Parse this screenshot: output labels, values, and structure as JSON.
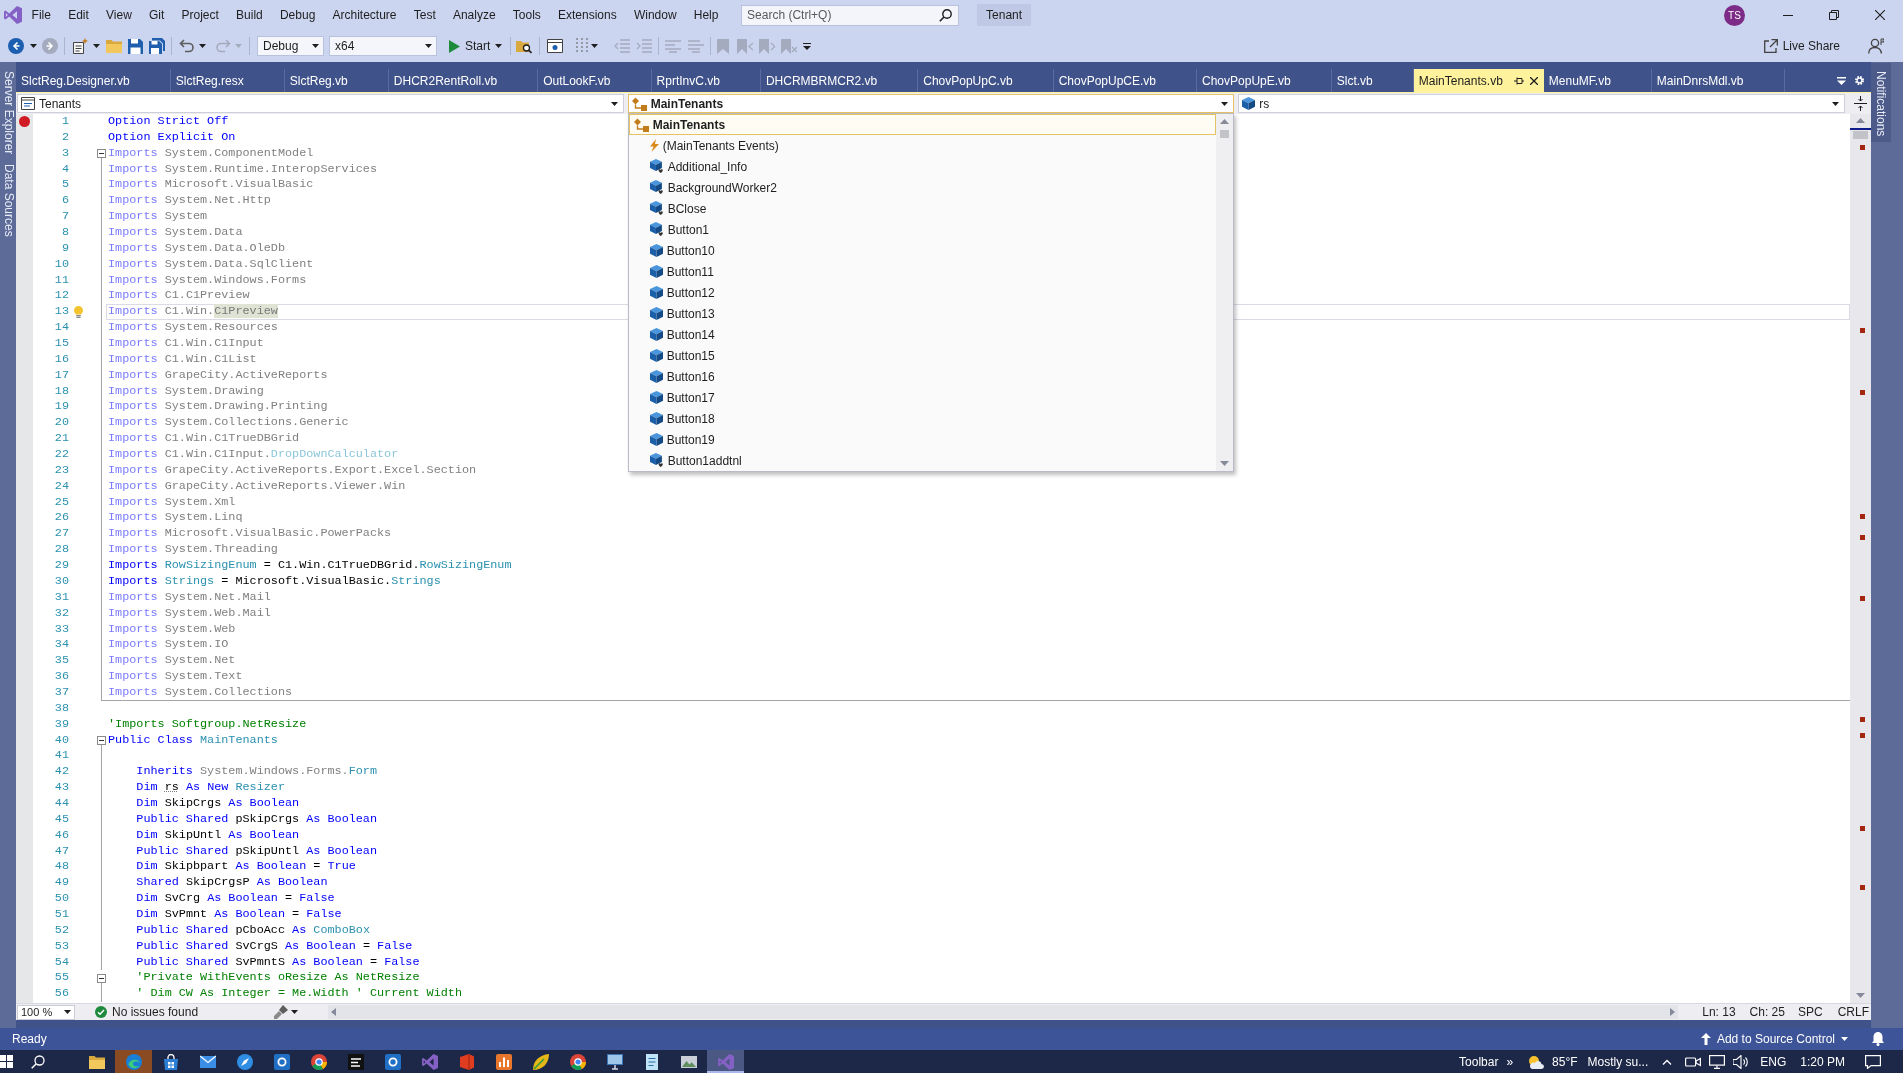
{
  "menu_bar": {
    "items": [
      "File",
      "Edit",
      "View",
      "Git",
      "Project",
      "Build",
      "Debug",
      "Architecture",
      "Test",
      "Analyze",
      "Tools",
      "Extensions",
      "Window",
      "Help"
    ],
    "search": {
      "placeholder": "Search (Ctrl+Q)"
    },
    "solution_name": "Tenant",
    "account_initials": "TS"
  },
  "toolbar": {
    "configuration": "Debug",
    "platform": "x64",
    "start": "Start",
    "live_share": "Live Share"
  },
  "left_tool_tabs": [
    "Server Explorer",
    "Data Sources"
  ],
  "right_tool_tabs": [
    "Notifications"
  ],
  "document_tabs": [
    {
      "label": "SlctReg.Designer.vb",
      "selected": false
    },
    {
      "label": "SlctReg.resx",
      "selected": false
    },
    {
      "label": "SlctReg.vb",
      "selected": false
    },
    {
      "label": "DHCR2RentRoll.vb",
      "selected": false
    },
    {
      "label": "OutLookF.vb",
      "selected": false
    },
    {
      "label": "RprtInvC.vb",
      "selected": false
    },
    {
      "label": "DHCRMBRMCR2.vb",
      "selected": false
    },
    {
      "label": "ChovPopUpC.vb",
      "selected": false
    },
    {
      "label": "ChovPopUpCE.vb",
      "selected": false
    },
    {
      "label": "ChovPopUpE.vb",
      "selected": false
    },
    {
      "label": "Slct.vb",
      "selected": false
    },
    {
      "label": "MainTenants.vb",
      "selected": true
    },
    {
      "label": "MenuMF.vb",
      "selected": false
    },
    {
      "label": "MainDnrsMdl.vb",
      "selected": false
    }
  ],
  "navigation_bar": {
    "project": "Tenants",
    "type": {
      "label": "MainTenants",
      "expanded": true,
      "items": [
        {
          "label": "MainTenants",
          "kind": "class",
          "selected": true,
          "children": [
            {
              "label": "(MainTenants Events)",
              "kind": "events",
              "selected": false
            },
            {
              "label": "Additional_Info",
              "kind": "friend_field",
              "selected": false
            },
            {
              "label": "BackgroundWorker2",
              "kind": "friend_field",
              "selected": false
            },
            {
              "label": "BClose",
              "kind": "friend_field",
              "selected": false
            },
            {
              "label": "Button1",
              "kind": "friend_field",
              "selected": false
            },
            {
              "label": "Button10",
              "kind": "field",
              "selected": false
            },
            {
              "label": "Button11",
              "kind": "field",
              "selected": false
            },
            {
              "label": "Button12",
              "kind": "field",
              "selected": false
            },
            {
              "label": "Button13",
              "kind": "field",
              "selected": false
            },
            {
              "label": "Button14",
              "kind": "field",
              "selected": false
            },
            {
              "label": "Button15",
              "kind": "field",
              "selected": false
            },
            {
              "label": "Button16",
              "kind": "field",
              "selected": false
            },
            {
              "label": "Button17",
              "kind": "field",
              "selected": false
            },
            {
              "label": "Button18",
              "kind": "field",
              "selected": false
            },
            {
              "label": "Button19",
              "kind": "field",
              "selected": false
            },
            {
              "label": "Button1addtnl",
              "kind": "friend_field",
              "selected": false
            }
          ]
        }
      ]
    },
    "member": "rs"
  },
  "editor": {
    "lines": [
      {
        "number": "1",
        "breakpoint": true,
        "tokens": [
          {
            "kind": "keyword",
            "text": "Option Strict Off"
          }
        ]
      },
      {
        "number": "2",
        "tokens": [
          {
            "kind": "keyword",
            "text": "Option Explicit On"
          }
        ]
      },
      {
        "number": "3",
        "expanded": true,
        "tokens": [
          {
            "kind": "keyword_dim",
            "text": "Imports"
          },
          {
            "kind": "name_dim",
            "text": " System.ComponentModel"
          }
        ],
        "children": [
          {
            "number": "4",
            "tokens": [
              {
                "kind": "keyword_dim",
                "text": "Imports"
              },
              {
                "kind": "name_dim",
                "text": " System.Runtime.InteropServices"
              }
            ]
          },
          {
            "number": "5",
            "tokens": [
              {
                "kind": "keyword_dim",
                "text": "Imports"
              },
              {
                "kind": "name_dim",
                "text": " Microsoft.VisualBasic"
              }
            ]
          },
          {
            "number": "6",
            "tokens": [
              {
                "kind": "keyword_dim",
                "text": "Imports"
              },
              {
                "kind": "name_dim",
                "text": " System.Net.Http"
              }
            ]
          },
          {
            "number": "7",
            "tokens": [
              {
                "kind": "keyword_dim",
                "text": "Imports"
              },
              {
                "kind": "name_dim",
                "text": " System"
              }
            ]
          },
          {
            "number": "8",
            "tokens": [
              {
                "kind": "keyword_dim",
                "text": "Imports"
              },
              {
                "kind": "name_dim",
                "text": " System.Data"
              }
            ]
          },
          {
            "number": "9",
            "tokens": [
              {
                "kind": "keyword_dim",
                "text": "Imports"
              },
              {
                "kind": "name_dim",
                "text": " System.Data.OleDb"
              }
            ]
          },
          {
            "number": "10",
            "tokens": [
              {
                "kind": "keyword_dim",
                "text": "Imports"
              },
              {
                "kind": "name_dim",
                "text": " System.Data.SqlClient"
              }
            ]
          },
          {
            "number": "11",
            "tokens": [
              {
                "kind": "keyword_dim",
                "text": "Imports"
              },
              {
                "kind": "name_dim",
                "text": " System.Windows.Forms"
              }
            ]
          },
          {
            "number": "12",
            "tokens": [
              {
                "kind": "keyword_dim",
                "text": "Imports"
              },
              {
                "kind": "name_dim",
                "text": " C1.C1Preview"
              }
            ]
          },
          {
            "number": "13",
            "current": true,
            "lightbulb": true,
            "tokens": [
              {
                "kind": "keyword_dim",
                "text": "Imports"
              },
              {
                "kind": "name_dim",
                "text": " C1.Win."
              },
              {
                "kind": "reference",
                "text": "C1Preview"
              }
            ]
          },
          {
            "number": "14",
            "tokens": [
              {
                "kind": "keyword_dim",
                "text": "Imports"
              },
              {
                "kind": "name_dim",
                "text": " System.Resources"
              }
            ]
          },
          {
            "number": "15",
            "tokens": [
              {
                "kind": "keyword_dim",
                "text": "Imports"
              },
              {
                "kind": "name_dim",
                "text": " C1.Win.C1Input"
              }
            ]
          },
          {
            "number": "16",
            "tokens": [
              {
                "kind": "keyword_dim",
                "text": "Imports"
              },
              {
                "kind": "name_dim",
                "text": " C1.Win.C1List"
              }
            ]
          },
          {
            "number": "17",
            "tokens": [
              {
                "kind": "keyword_dim",
                "text": "Imports"
              },
              {
                "kind": "name_dim",
                "text": " GrapeCity.ActiveReports"
              }
            ]
          },
          {
            "number": "18",
            "tokens": [
              {
                "kind": "keyword_dim",
                "text": "Imports"
              },
              {
                "kind": "name_dim",
                "text": " System.Drawing"
              }
            ]
          },
          {
            "number": "19",
            "tokens": [
              {
                "kind": "keyword_dim",
                "text": "Imports"
              },
              {
                "kind": "name_dim",
                "text": " System.Drawing.Printing"
              }
            ]
          },
          {
            "number": "20",
            "tokens": [
              {
                "kind": "keyword_dim",
                "text": "Imports"
              },
              {
                "kind": "name_dim",
                "text": " System.Collections.Generic"
              }
            ]
          },
          {
            "number": "21",
            "tokens": [
              {
                "kind": "keyword_dim",
                "text": "Imports"
              },
              {
                "kind": "name_dim",
                "text": " C1.Win.C1TrueDBGrid"
              }
            ]
          },
          {
            "number": "22",
            "tokens": [
              {
                "kind": "keyword_dim",
                "text": "Imports"
              },
              {
                "kind": "name_dim",
                "text": " C1.Win.C1Input."
              },
              {
                "kind": "type_dim",
                "text": "DropDownCalculator"
              }
            ]
          },
          {
            "number": "23",
            "tokens": [
              {
                "kind": "keyword_dim",
                "text": "Imports"
              },
              {
                "kind": "name_dim",
                "text": " GrapeCity.ActiveReports.Export.Excel.Section"
              }
            ]
          },
          {
            "number": "24",
            "tokens": [
              {
                "kind": "keyword_dim",
                "text": "Imports"
              },
              {
                "kind": "name_dim",
                "text": " GrapeCity.ActiveReports.Viewer.Win"
              }
            ]
          },
          {
            "number": "25",
            "tokens": [
              {
                "kind": "keyword_dim",
                "text": "Imports"
              },
              {
                "kind": "name_dim",
                "text": " System.Xml"
              }
            ]
          },
          {
            "number": "26",
            "tokens": [
              {
                "kind": "keyword_dim",
                "text": "Imports"
              },
              {
                "kind": "name_dim",
                "text": " System.Linq"
              }
            ]
          },
          {
            "number": "27",
            "tokens": [
              {
                "kind": "keyword_dim",
                "text": "Imports"
              },
              {
                "kind": "name_dim",
                "text": " Microsoft.VisualBasic.PowerPacks"
              }
            ]
          },
          {
            "number": "28",
            "tokens": [
              {
                "kind": "keyword_dim",
                "text": "Imports"
              },
              {
                "kind": "name_dim",
                "text": " System.Threading"
              }
            ]
          },
          {
            "number": "29",
            "tokens": [
              {
                "kind": "keyword",
                "text": "Imports "
              },
              {
                "kind": "type",
                "text": "RowSizingEnum"
              },
              {
                "kind": "name",
                "text": " = C1.Win.C1TrueDBGrid."
              },
              {
                "kind": "type",
                "text": "RowSizingEnum"
              }
            ]
          },
          {
            "number": "30",
            "tokens": [
              {
                "kind": "keyword",
                "text": "Imports "
              },
              {
                "kind": "type",
                "text": "Strings"
              },
              {
                "kind": "name",
                "text": " = Microsoft.VisualBasic."
              },
              {
                "kind": "type",
                "text": "Strings"
              }
            ]
          },
          {
            "number": "31",
            "tokens": [
              {
                "kind": "keyword_dim",
                "text": "Imports"
              },
              {
                "kind": "name_dim",
                "text": " System.Net.Mail"
              }
            ]
          },
          {
            "number": "32",
            "tokens": [
              {
                "kind": "keyword_dim",
                "text": "Imports"
              },
              {
                "kind": "name_dim",
                "text": " System.Web.Mail"
              }
            ]
          },
          {
            "number": "33",
            "tokens": [
              {
                "kind": "keyword_dim",
                "text": "Imports"
              },
              {
                "kind": "name_dim",
                "text": " System.Web"
              }
            ]
          },
          {
            "number": "34",
            "tokens": [
              {
                "kind": "keyword_dim",
                "text": "Imports"
              },
              {
                "kind": "name_dim",
                "text": " System.IO"
              }
            ]
          },
          {
            "number": "35",
            "tokens": [
              {
                "kind": "keyword_dim",
                "text": "Imports"
              },
              {
                "kind": "name_dim",
                "text": " System.Net"
              }
            ]
          },
          {
            "number": "36",
            "tokens": [
              {
                "kind": "keyword_dim",
                "text": "Imports"
              },
              {
                "kind": "name_dim",
                "text": " System.Text"
              }
            ]
          },
          {
            "number": "37",
            "tokens": [
              {
                "kind": "keyword_dim",
                "text": "Imports"
              },
              {
                "kind": "name_dim",
                "text": " System.Collections"
              }
            ]
          }
        ]
      },
      {
        "number": "38"
      },
      {
        "number": "39",
        "tokens": [
          {
            "kind": "comment",
            "text": "'Imports Softgroup.NetResize"
          }
        ]
      },
      {
        "number": "40",
        "expanded": true,
        "tokens": [
          {
            "kind": "keyword",
            "text": "Public Class "
          },
          {
            "kind": "type",
            "text": "MainTenants"
          }
        ],
        "children": [
          {
            "number": "41"
          },
          {
            "number": "42",
            "tokens": [
              {
                "kind": "keyword",
                "text": "    Inherits "
              },
              {
                "kind": "name_dim",
                "text": "System.Windows.Forms."
              },
              {
                "kind": "type",
                "text": "Form"
              }
            ]
          },
          {
            "number": "43",
            "tokens": [
              {
                "kind": "keyword",
                "text": "    Dim "
              },
              {
                "kind": "hint",
                "text": "rs"
              },
              {
                "kind": "keyword",
                "text": " As New "
              },
              {
                "kind": "type",
                "text": "Resizer"
              }
            ]
          },
          {
            "number": "44",
            "tokens": [
              {
                "kind": "keyword",
                "text": "    Dim "
              },
              {
                "kind": "name",
                "text": "SkipCrgs "
              },
              {
                "kind": "keyword",
                "text": "As Boolean"
              }
            ]
          },
          {
            "number": "45",
            "tokens": [
              {
                "kind": "keyword",
                "text": "    Public Shared "
              },
              {
                "kind": "name",
                "text": "pSkipCrgs "
              },
              {
                "kind": "keyword",
                "text": "As Boolean"
              }
            ]
          },
          {
            "number": "46",
            "tokens": [
              {
                "kind": "keyword",
                "text": "    Dim "
              },
              {
                "kind": "name",
                "text": "SkipUntl "
              },
              {
                "kind": "keyword",
                "text": "As Boolean"
              }
            ]
          },
          {
            "number": "47",
            "tokens": [
              {
                "kind": "keyword",
                "text": "    Public Shared "
              },
              {
                "kind": "name",
                "text": "pSkipUntl "
              },
              {
                "kind": "keyword",
                "text": "As Boolean"
              }
            ]
          },
          {
            "number": "48",
            "tokens": [
              {
                "kind": "keyword",
                "text": "    Dim "
              },
              {
                "kind": "name",
                "text": "Skipbpart "
              },
              {
                "kind": "keyword",
                "text": "As Boolean "
              },
              {
                "kind": "name",
                "text": "= "
              },
              {
                "kind": "keyword",
                "text": "True"
              }
            ]
          },
          {
            "number": "49",
            "tokens": [
              {
                "kind": "keyword",
                "text": "    Shared "
              },
              {
                "kind": "name",
                "text": "SkipCrgsP "
              },
              {
                "kind": "keyword",
                "text": "As Boolean"
              }
            ]
          },
          {
            "number": "50",
            "tokens": [
              {
                "kind": "keyword",
                "text": "    Dim "
              },
              {
                "kind": "name",
                "text": "SvCrg "
              },
              {
                "kind": "keyword",
                "text": "As Boolean "
              },
              {
                "kind": "name",
                "text": "= "
              },
              {
                "kind": "keyword",
                "text": "False"
              }
            ]
          },
          {
            "number": "51",
            "tokens": [
              {
                "kind": "keyword",
                "text": "    Dim "
              },
              {
                "kind": "name",
                "text": "SvPmnt "
              },
              {
                "kind": "keyword",
                "text": "As Boolean "
              },
              {
                "kind": "name",
                "text": "= "
              },
              {
                "kind": "keyword",
                "text": "False"
              }
            ]
          },
          {
            "number": "52",
            "tokens": [
              {
                "kind": "keyword",
                "text": "    Public Shared "
              },
              {
                "kind": "name",
                "text": "pCboAcc "
              },
              {
                "kind": "keyword",
                "text": "As "
              },
              {
                "kind": "type",
                "text": "ComboBox"
              }
            ]
          },
          {
            "number": "53",
            "tokens": [
              {
                "kind": "keyword",
                "text": "    Public Shared "
              },
              {
                "kind": "name",
                "text": "SvCrgS "
              },
              {
                "kind": "keyword",
                "text": "As Boolean "
              },
              {
                "kind": "name",
                "text": "= "
              },
              {
                "kind": "keyword",
                "text": "False"
              }
            ]
          },
          {
            "number": "54",
            "tokens": [
              {
                "kind": "keyword",
                "text": "    Public Shared "
              },
              {
                "kind": "name",
                "text": "SvPmntS "
              },
              {
                "kind": "keyword",
                "text": "As Boolean "
              },
              {
                "kind": "name",
                "text": "= "
              },
              {
                "kind": "keyword",
                "text": "False"
              }
            ]
          },
          {
            "number": "55",
            "expanded": true,
            "tokens": [
              {
                "kind": "comment",
                "text": "    'Private WithEvents oResize As NetResize"
              }
            ],
            "children": [
              {
                "number": "56",
                "tokens": [
                  {
                    "kind": "comment",
                    "text": "    ' Dim CW As Integer = Me.Width ' Current Width"
                  }
                ]
              }
            ]
          }
        ]
      }
    ]
  },
  "editor_status": {
    "zoom": "100 %",
    "issues": "No issues found",
    "line": "Ln: 13",
    "column": "Ch: 25",
    "indentation": "SPC",
    "line_endings": "CRLF"
  },
  "status_bar": {
    "text": "Ready",
    "source_control": "Add to Source Control"
  },
  "taskbar": {
    "apps": [
      {
        "kind": "folder",
        "selected": false,
        "flashing": false
      },
      {
        "kind": "swirl",
        "selected": false,
        "flashing": true
      },
      {
        "kind": "bag",
        "selected": false,
        "flashing": false
      },
      {
        "kind": "envelope",
        "selected": false,
        "flashing": false
      },
      {
        "kind": "compass",
        "selected": false,
        "flashing": false
      },
      {
        "kind": "tile",
        "selected": false,
        "flashing": false
      },
      {
        "kind": "ring",
        "selected": false,
        "flashing": false
      },
      {
        "kind": "box",
        "selected": false,
        "flashing": false
      },
      {
        "kind": "tile",
        "selected": false,
        "flashing": false
      },
      {
        "kind": "logo",
        "selected": false,
        "flashing": false
      },
      {
        "kind": "square",
        "selected": false,
        "flashing": false
      },
      {
        "kind": "bars",
        "selected": false,
        "flashing": false
      },
      {
        "kind": "leaf",
        "selected": false,
        "flashing": false
      },
      {
        "kind": "ring",
        "selected": false,
        "flashing": false
      },
      {
        "kind": "monitor",
        "selected": false,
        "flashing": false
      },
      {
        "kind": "notepad",
        "selected": false,
        "flashing": false
      },
      {
        "kind": "picture",
        "selected": false,
        "flashing": false
      },
      {
        "kind": "logo",
        "selected": true,
        "flashing": false
      }
    ],
    "toolbar_label": "Toolbar",
    "overflow": "»",
    "temperature": "85°F",
    "weather": "Mostly su...",
    "language": "ENG",
    "time": "1:20 PM"
  }
}
